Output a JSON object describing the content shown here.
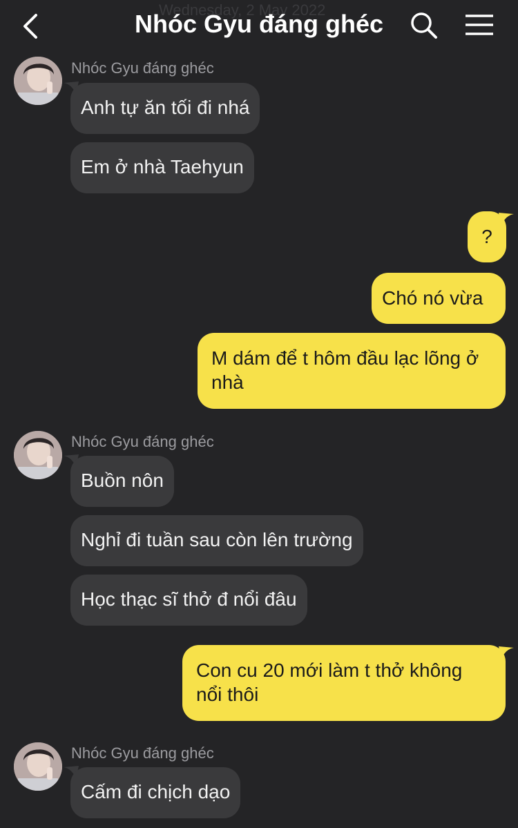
{
  "header": {
    "date_ghost": "Wednesday, 2 May 2022",
    "title": "Nhóc Gyu đáng ghéc"
  },
  "colors": {
    "background": "#242426",
    "incoming_bubble": "#3a3a3c",
    "outgoing_bubble": "#f7e14a"
  },
  "messages": {
    "group1": {
      "sender": "Nhóc Gyu đáng ghéc",
      "m1": "Anh tự ăn tối đi nhá",
      "m2": "Em ở nhà Taehyun"
    },
    "out1": {
      "m1": "?",
      "m2": "Chó nó vừa",
      "m3": "M dám để t hôm đầu lạc lõng ở nhà"
    },
    "group2": {
      "sender": "Nhóc Gyu đáng ghéc",
      "m1": "Buồn nôn",
      "m2": "Nghỉ đi tuần sau còn lên trường",
      "m3": "Học thạc sĩ thở đ nổi đâu"
    },
    "out2": {
      "m1": "Con cu 20 mới làm t thở không nổi thôi"
    },
    "group3": {
      "sender": "Nhóc Gyu đáng ghéc",
      "m1": "Cấm đi chịch dạo"
    }
  }
}
